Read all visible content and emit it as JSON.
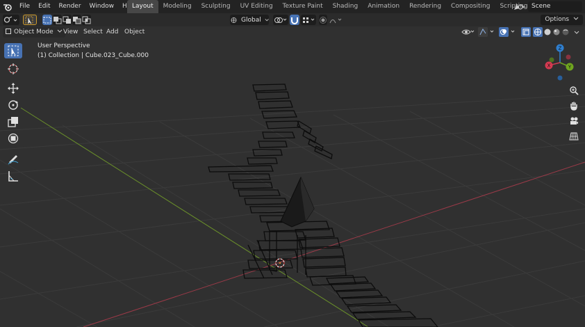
{
  "menu": {
    "items": [
      "File",
      "Edit",
      "Render",
      "Window",
      "Help"
    ]
  },
  "workspace_tabs": [
    "Layout",
    "Modeling",
    "Sculpting",
    "UV Editing",
    "Texture Paint",
    "Shading",
    "Animation",
    "Rendering",
    "Compositing",
    "Scripting"
  ],
  "active_tab": "Layout",
  "add_tab_symbol": "+",
  "scene": {
    "name": "Scene"
  },
  "header": {
    "transform_orientation": "Global",
    "options_label": "Options"
  },
  "viewport_header": {
    "mode": "Object Mode",
    "menus": [
      "View",
      "Select",
      "Add",
      "Object"
    ]
  },
  "viewport": {
    "perspective_label": "User Perspective",
    "collection_label": "(1) Collection | Cube.023_Cube.000"
  },
  "gizmo": {
    "x": "X",
    "y": "Y",
    "z": "Z"
  },
  "colors": {
    "accent": "#4772b3",
    "x_axis": "#d43a51",
    "y_axis": "#6fa51f",
    "z_axis": "#2f7fd0",
    "background": "#303030",
    "grid": "#3c3c3c"
  },
  "icons": [
    "blender-logo",
    "select-box-icon",
    "cursor-icon",
    "move-icon",
    "rotate-icon",
    "scale-icon",
    "transform-icon",
    "annotate-icon",
    "measure-icon",
    "zoom-icon",
    "hand-icon",
    "camera-icon",
    "grid-view-icon"
  ]
}
